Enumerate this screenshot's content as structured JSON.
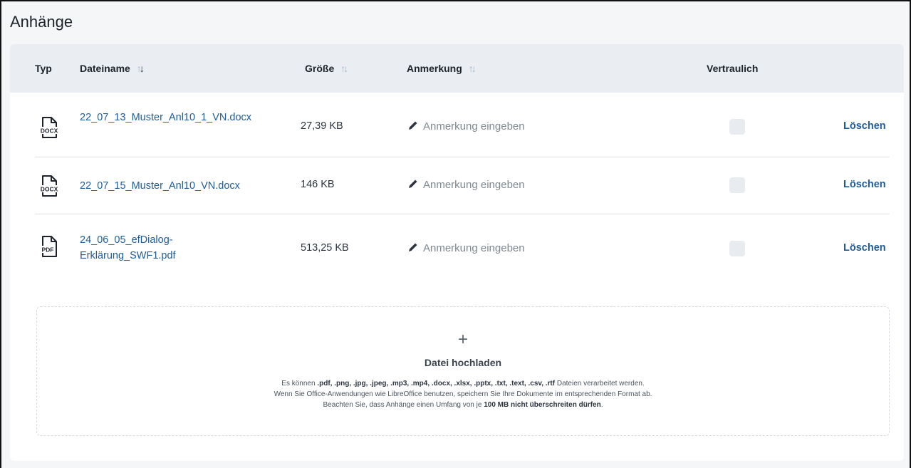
{
  "section_title": "Anhänge",
  "columns": {
    "type": "Typ",
    "filename": "Dateiname",
    "size": "Größe",
    "note": "Anmerkung",
    "confidential": "Vertraulich"
  },
  "sort_icon": "sort-arrows-icon",
  "rows": [
    {
      "icon": "docx-file-icon",
      "icon_label": "DOCX",
      "filename": "22_07_13_Muster_Anl10_1_VN.docx",
      "size": "27,39 KB",
      "note_placeholder": "Anmerkung eingeben",
      "confidential": false,
      "delete_label": "Löschen"
    },
    {
      "icon": "docx-file-icon",
      "icon_label": "DOCX",
      "filename": "22_07_15_Muster_Anl10_VN.docx",
      "size": "146 KB",
      "note_placeholder": "Anmerkung eingeben",
      "confidential": false,
      "delete_label": "Löschen"
    },
    {
      "icon": "pdf-file-icon",
      "icon_label": "PDF",
      "filename": "24_06_05_efDialog-Erklärung_SWF1.pdf",
      "size": "513,25 KB",
      "note_placeholder": "Anmerkung eingeben",
      "confidential": false,
      "delete_label": "Löschen"
    }
  ],
  "upload": {
    "icon": "plus-icon",
    "plus": "+",
    "title": "Datei hochladen",
    "line1_prefix": "Es können ",
    "line1_formats": ".pdf, .png, .jpg, .jpeg, .mp3, .mp4, .docx, .xlsx, .pptx, .txt, .text, .csv, .rtf",
    "line1_suffix": " Dateien verarbeitet werden.",
    "line2": "Wenn Sie Office-Anwendungen wie LibreOffice benutzen, speichern Sie Ihre Dokumente im entsprechenden Format ab.",
    "line3_prefix": "Beachten Sie, dass Anhänge einen Umfang von je ",
    "line3_bold": "100 MB nicht überschreiten dürfen",
    "line3_suffix": "."
  },
  "colors": {
    "link": "#1f5b9a",
    "header_bg": "#eaeef2",
    "page_bg": "#f4f6f8"
  }
}
